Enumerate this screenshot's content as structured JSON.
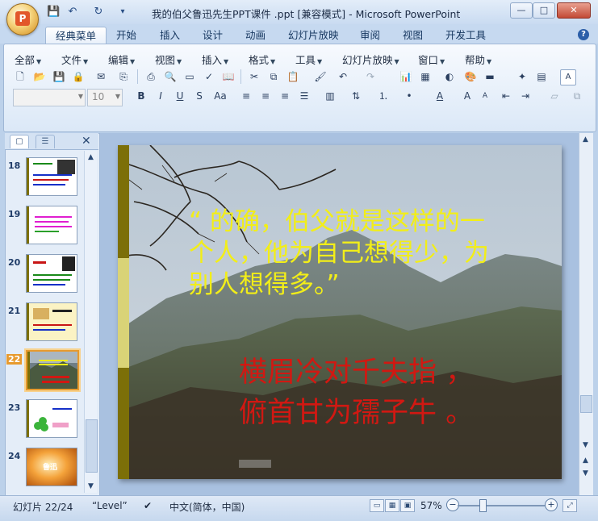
{
  "window": {
    "title": "我的伯父鲁迅先生PPT课件 .ppt [兼容模式] - Microsoft PowerPoint",
    "controls": {
      "minimize": "—",
      "maximize": "□",
      "close": "✕"
    }
  },
  "qat": {
    "save": "💾",
    "undo": "↶",
    "redo": "↻",
    "customize": "▾"
  },
  "ribbon_tabs": [
    "经典菜单",
    "开始",
    "插入",
    "设计",
    "动画",
    "幻灯片放映",
    "审阅",
    "视图",
    "开发工具"
  ],
  "active_tab": "经典菜单",
  "help": "?",
  "classic_menus": [
    "全部",
    "文件",
    "编辑",
    "视图",
    "插入",
    "格式",
    "工具",
    "幻灯片放映",
    "窗口",
    "帮助"
  ],
  "toolbar": {
    "font_name": "",
    "font_size": "10",
    "format_buttons": [
      "B",
      "I",
      "U",
      "S",
      "Aa"
    ]
  },
  "slides_panel": {
    "thumbnails": [
      {
        "number": "18",
        "thumb_text": ""
      },
      {
        "number": "19",
        "thumb_text": ""
      },
      {
        "number": "20",
        "thumb_text": ""
      },
      {
        "number": "21",
        "thumb_text": ""
      },
      {
        "number": "22",
        "thumb_text": ""
      },
      {
        "number": "23",
        "thumb_text": ""
      },
      {
        "number": "24",
        "thumb_text": "鲁迅"
      }
    ],
    "selected": "22"
  },
  "slide": {
    "quote": "“ 的确，伯父就是这样的一个人，他为自己想得少，为别人想得多。”",
    "couplet_line1": "横眉冷对千夫指 ，",
    "couplet_line2": "俯首甘为孺子牛 。"
  },
  "colors": {
    "quote_text": "#f2ee18",
    "couplet_text": "#d11812",
    "bar_dark": "#7c6f08",
    "bar_light": "#d9d377",
    "selected_thumb": "#e79a2e"
  },
  "status": {
    "slide_counter": "幻灯片 22/24",
    "theme": "“Level”",
    "language": "中文(简体，中国)",
    "zoom": "57%"
  }
}
